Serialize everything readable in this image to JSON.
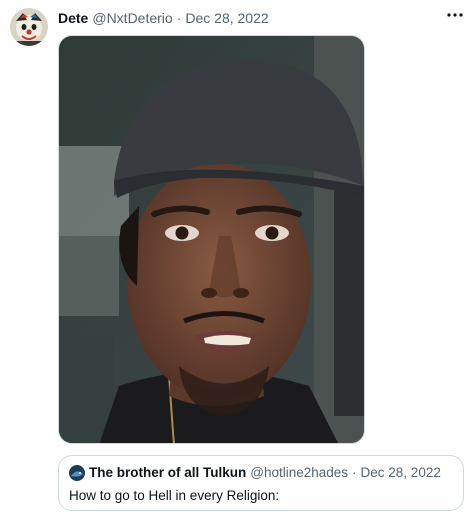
{
  "tweet": {
    "author_name": "Dete",
    "author_handle": "@NxtDeterio",
    "separator": "·",
    "date": "Dec 28, 2022",
    "more_icon": "more-horizontal-icon",
    "media_description_icon": "video-thumbnail"
  },
  "quote": {
    "author_name": "The brother of all Tulkun",
    "author_handle": "@hotline2hades",
    "separator": "·",
    "date": "Dec 28, 2022",
    "text": "How to go to Hell in every Religion:"
  },
  "colors": {
    "primary_text": "#0f1419",
    "secondary_text": "#536471",
    "border": "#cfd9de",
    "background": "#ffffff"
  }
}
